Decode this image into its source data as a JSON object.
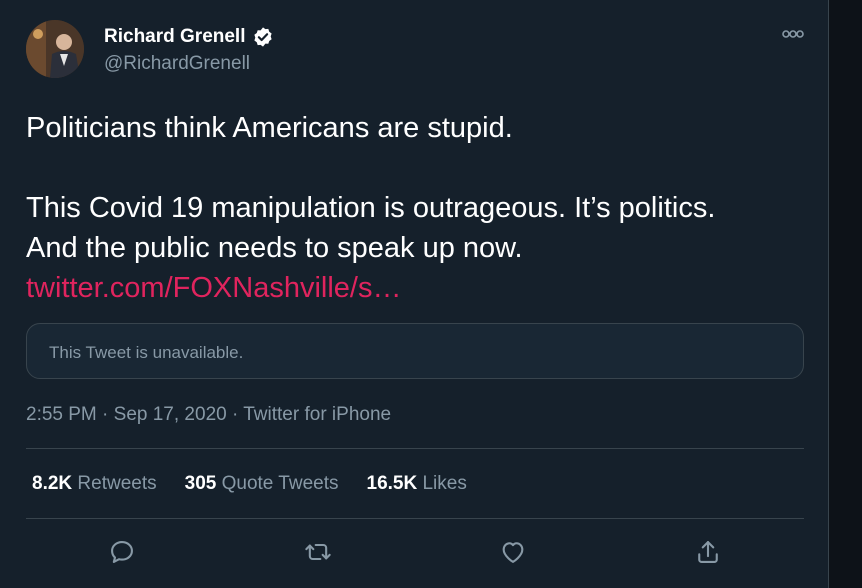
{
  "author": {
    "name": "Richard Grenell",
    "handle": "@RichardGrenell",
    "verified": true
  },
  "tweet": {
    "line1": "Politicians think Americans are stupid.",
    "line2": "This Covid 19 manipulation is outrageous. It’s politics.",
    "line3": "And the public needs to speak up now.",
    "link": "twitter.com/FOXNashville/s…"
  },
  "quoted": {
    "message": "This Tweet is unavailable."
  },
  "meta": {
    "time": "2:55 PM",
    "date": "Sep 17, 2020",
    "source": "Twitter for iPhone"
  },
  "stats": [
    {
      "value": "8.2K",
      "label": "Retweets"
    },
    {
      "value": "305",
      "label": "Quote Tweets"
    },
    {
      "value": "16.5K",
      "label": "Likes"
    }
  ],
  "colors": {
    "background": "#15202b",
    "link": "#e0245e",
    "muted": "#8899a6",
    "border": "#38444d"
  },
  "icons": [
    "more-icon",
    "verified-icon",
    "reply-icon",
    "retweet-icon",
    "like-icon",
    "share-icon"
  ]
}
